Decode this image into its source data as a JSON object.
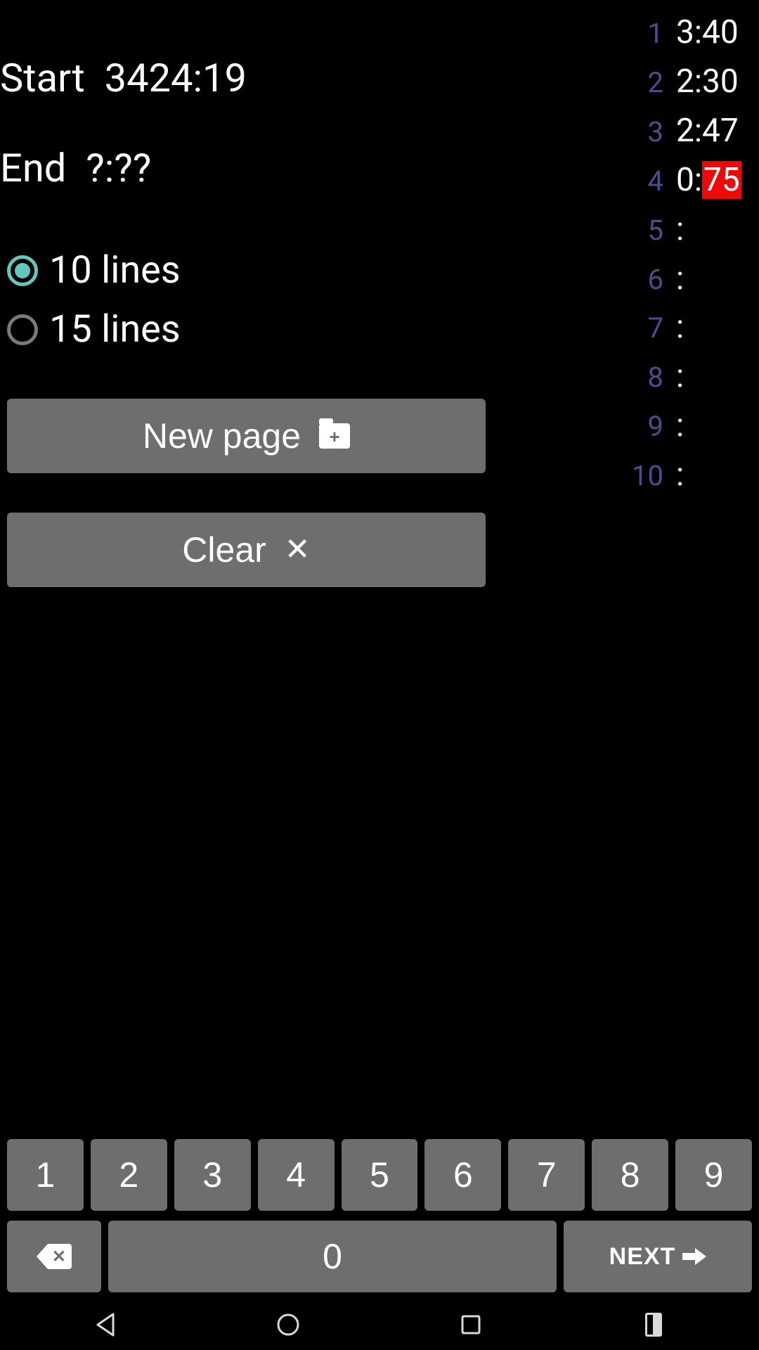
{
  "start": {
    "label": "Start",
    "value": "3424:19"
  },
  "end": {
    "label": "End",
    "value": "?:??"
  },
  "radios": {
    "opt10": "10 lines",
    "opt15": "15 lines",
    "selected": "opt10"
  },
  "buttons": {
    "new_page": "New page",
    "clear": "Clear",
    "next": "NEXT"
  },
  "times": [
    {
      "idx": "1",
      "min": "3",
      "sec": "40",
      "highlight_sec": false
    },
    {
      "idx": "2",
      "min": "2",
      "sec": "30",
      "highlight_sec": false
    },
    {
      "idx": "3",
      "min": "2",
      "sec": "47",
      "highlight_sec": false
    },
    {
      "idx": "4",
      "min": "0",
      "sec": "75",
      "highlight_sec": true
    },
    {
      "idx": "5",
      "min": "",
      "sec": "",
      "highlight_sec": false
    },
    {
      "idx": "6",
      "min": "",
      "sec": "",
      "highlight_sec": false
    },
    {
      "idx": "7",
      "min": "",
      "sec": "",
      "highlight_sec": false
    },
    {
      "idx": "8",
      "min": "",
      "sec": "",
      "highlight_sec": false
    },
    {
      "idx": "9",
      "min": "",
      "sec": "",
      "highlight_sec": false
    },
    {
      "idx": "10",
      "min": "",
      "sec": "",
      "highlight_sec": false
    }
  ],
  "keypad": {
    "k1": "1",
    "k2": "2",
    "k3": "3",
    "k4": "4",
    "k5": "5",
    "k6": "6",
    "k7": "7",
    "k8": "8",
    "k9": "9",
    "k0": "0"
  }
}
